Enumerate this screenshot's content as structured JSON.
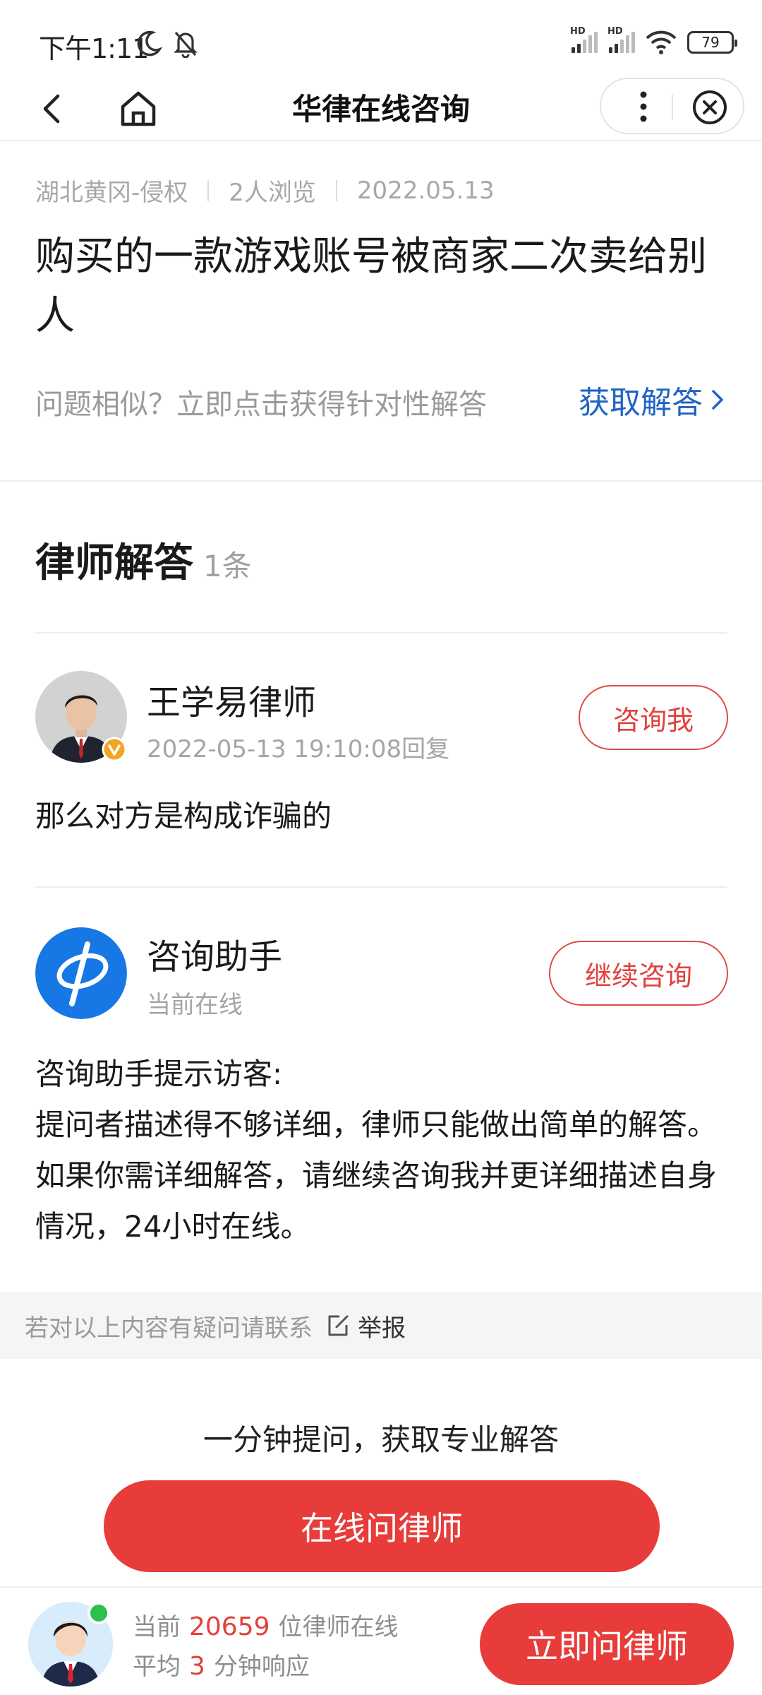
{
  "status_bar": {
    "time": "下午1:11",
    "signal1_label": "HD",
    "signal2_label": "HD",
    "battery": "79"
  },
  "nav": {
    "title": "华律在线咨询"
  },
  "question": {
    "location": "湖北黄冈-侵权",
    "views": "2人浏览",
    "date": "2022.05.13",
    "title": "购买的一款游戏账号被商家二次卖给别人",
    "similar_prompt": "问题相似？立即点击获得针对性解答",
    "get_answer_label": "获取解答"
  },
  "answers": {
    "heading": "律师解答",
    "count": "1条",
    "items": [
      {
        "name": "王学易律师",
        "time": "2022-05-13 19:10:08回复",
        "button": "咨询我",
        "content": "那么对方是构成诈骗的"
      }
    ]
  },
  "assistant": {
    "name": "咨询助手",
    "status": "当前在线",
    "button": "继续咨询",
    "line1": "咨询助手提示访客:",
    "line2": "提问者描述得不够详细，律师只能做出简单的解答。如果你需详细解答，请继续咨询我并更详细描述自身情况，24小时在线。"
  },
  "report": {
    "text": "若对以上内容有疑问请联系",
    "link": "举报"
  },
  "cta": {
    "subtitle": "一分钟提问，获取专业解答",
    "button": "在线问律师"
  },
  "bottom": {
    "line1_prefix": "当前",
    "online_count": "20659",
    "line1_suffix": "位律师在线",
    "line2_prefix": "平均",
    "response_minutes": "3",
    "line2_suffix": "分钟响应",
    "button": "立即问律师"
  },
  "colors": {
    "accent_red": "#e73c3a",
    "link_blue": "#1e63c6"
  }
}
